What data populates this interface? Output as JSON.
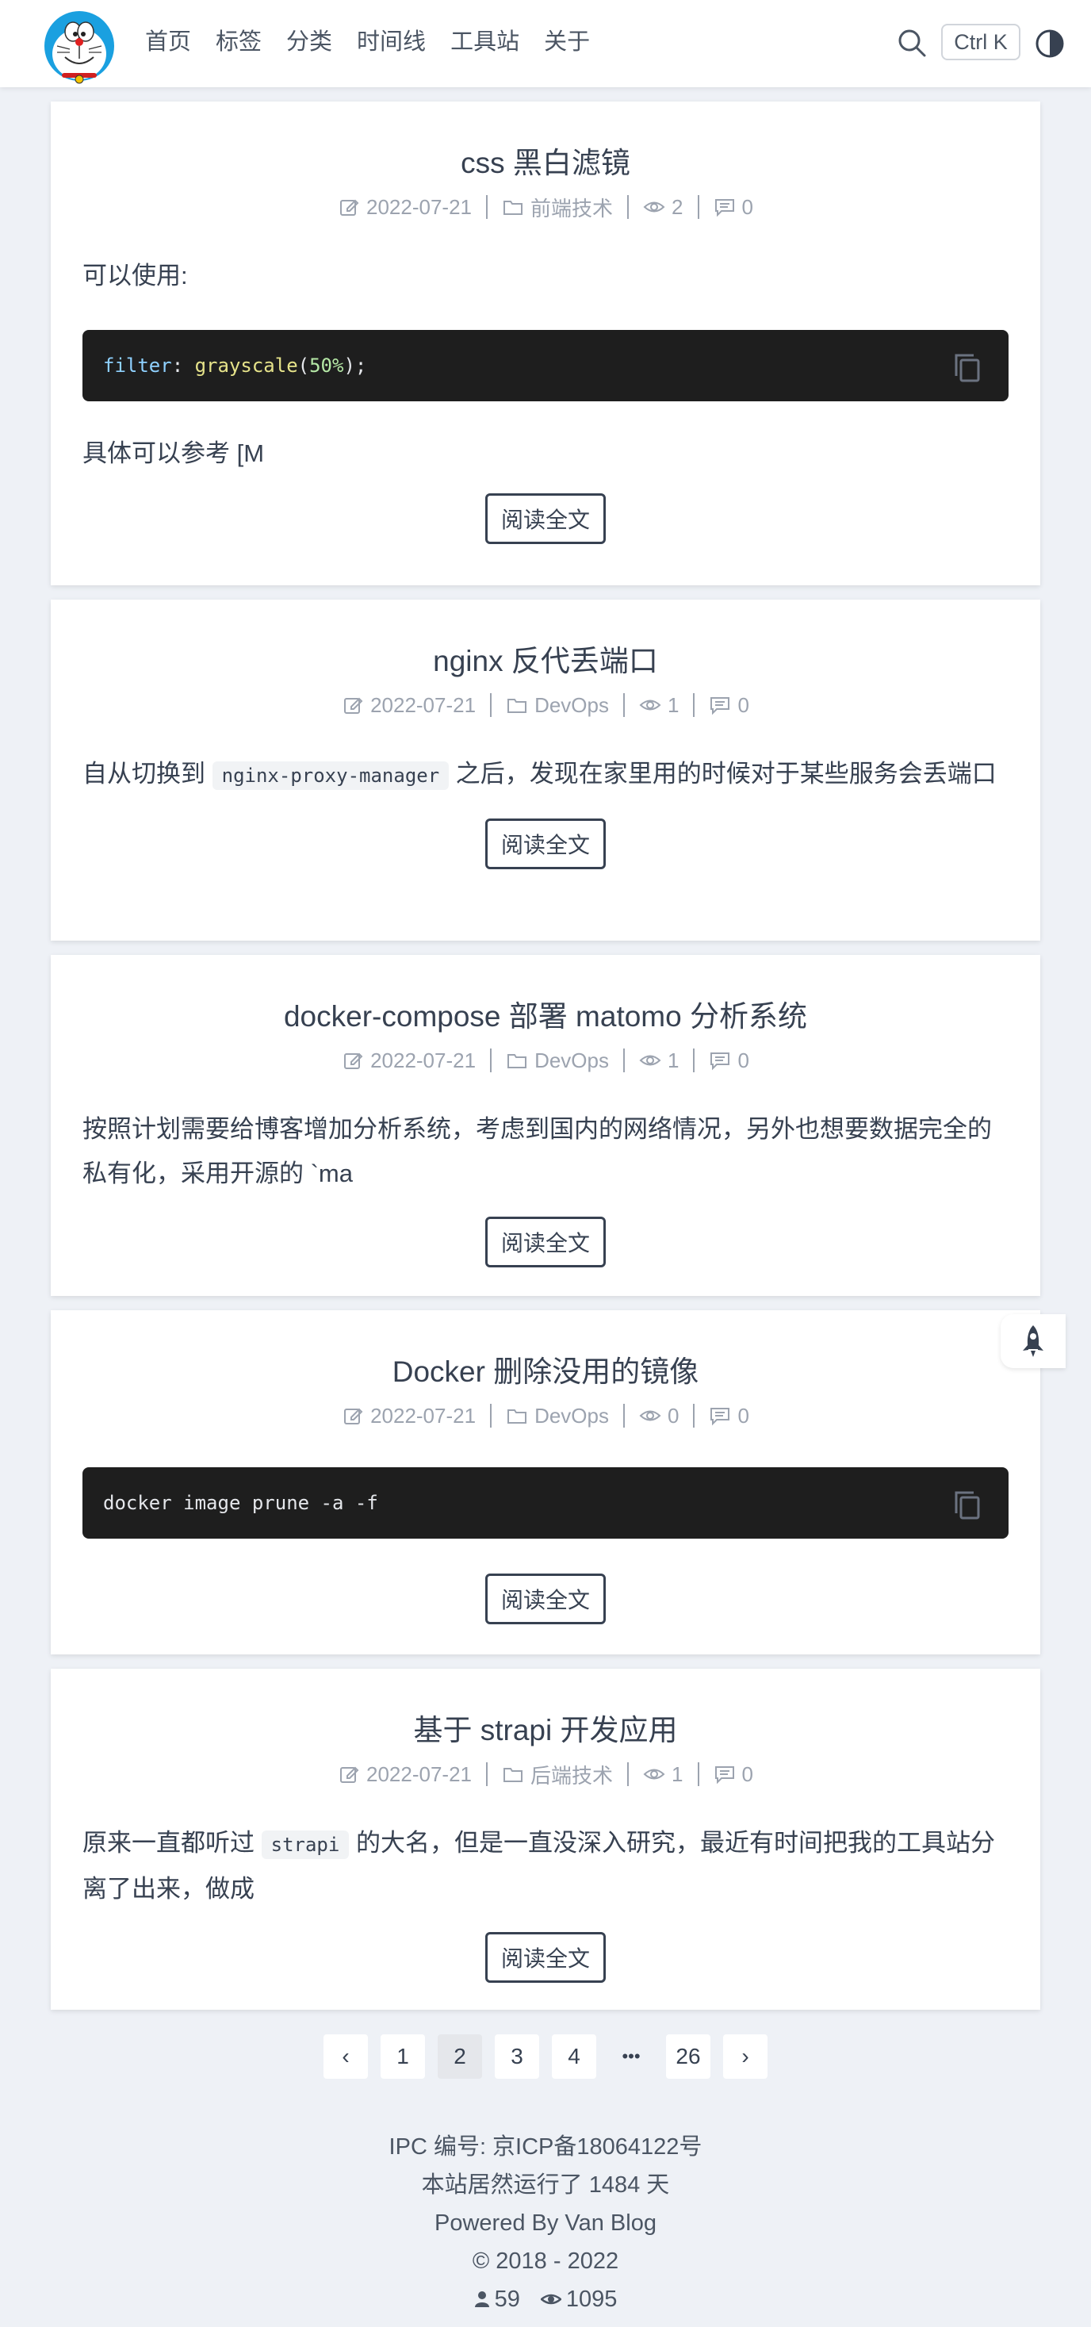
{
  "header": {
    "nav": [
      "首页",
      "标签",
      "分类",
      "时间线",
      "工具站",
      "关于"
    ],
    "search_shortcut": "Ctrl K"
  },
  "posts": [
    {
      "title": "css 黑白滤镜",
      "date": "2022-07-21",
      "category": "前端技术",
      "views": "2",
      "comments": "0",
      "intro": "可以使用:",
      "code_tokens": {
        "prop": "filter",
        "colon": ": ",
        "fn": "grayscale",
        "paren_open": "(",
        "num": "50%",
        "end": ");"
      },
      "outro": "具体可以参考 [M"
    },
    {
      "title": "nginx 反代丢端口",
      "date": "2022-07-21",
      "category": "DevOps",
      "views": "1",
      "comments": "0",
      "text_before": "自从切换到 ",
      "inline_code": "nginx-proxy-manager",
      "text_after": " 之后，发现在家里用的时候对于某些服务会丢端口"
    },
    {
      "title": "docker-compose 部署 matomo 分析系统",
      "date": "2022-07-21",
      "category": "DevOps",
      "views": "1",
      "comments": "0",
      "excerpt": "按照计划需要给博客增加分析系统，考虑到国内的网络情况，另外也想要数据完全的私有化，采用开源的 `ma"
    },
    {
      "title": "Docker 删除没用的镜像",
      "date": "2022-07-21",
      "category": "DevOps",
      "views": "0",
      "comments": "0",
      "code": "docker image prune -a -f"
    },
    {
      "title": "基于 strapi 开发应用",
      "date": "2022-07-21",
      "category": "后端技术",
      "views": "1",
      "comments": "0",
      "text_before": "原来一直都听过 ",
      "inline_code": "strapi",
      "text_after": " 的大名，但是一直没深入研究，最近有时间把我的工具站分离了出来，做成"
    }
  ],
  "read_more": "阅读全文",
  "pagination": {
    "prev": "‹",
    "pages": [
      "1",
      "2",
      "3",
      "4"
    ],
    "current": "2",
    "ellipsis": "•••",
    "last": "26",
    "next": "›"
  },
  "footer": {
    "icp": "IPC 编号: 京ICP备18064122号",
    "uptime": "本站居然运行了 1484 天",
    "powered": "Powered By Van Blog",
    "copyright": "© 2018 - 2022",
    "visitors": "59",
    "pageviews": "1095"
  },
  "colors": {
    "background": "#eef1f6",
    "code_bg": "#1e1e1e",
    "text": "#374151",
    "meta": "#9ca3af"
  }
}
